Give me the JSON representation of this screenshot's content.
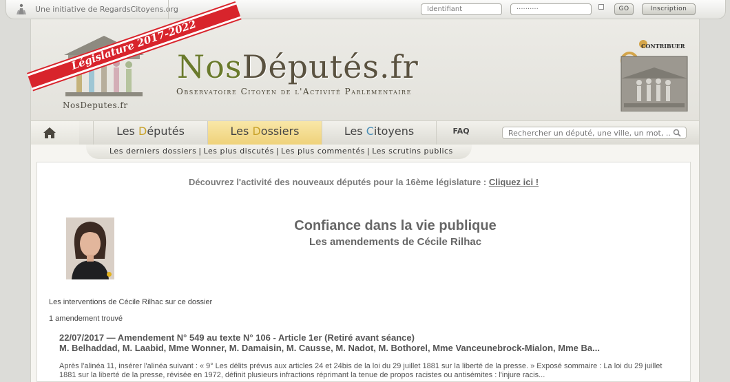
{
  "topbar": {
    "initiative_text": "Une initiative de RegardsCitoyens.org",
    "login_placeholder": "Identifiant",
    "password_placeholder": "··········",
    "go_label": "GO",
    "signup_label": "Inscription"
  },
  "header": {
    "banner": "Législature 2017-2022",
    "logo_name": "NosDeputes.fr",
    "title_prefix": "Nos",
    "title_rest": "Députés.fr",
    "tagline": "Observatoire Citoyen de l'Activité Parlementaire",
    "contribute": "CONTRIBUER"
  },
  "nav": {
    "tabs": [
      {
        "prefix": "Les ",
        "initial": "D",
        "rest": "éputés"
      },
      {
        "prefix": "Les ",
        "initial": "D",
        "rest": "ossiers"
      },
      {
        "prefix": "Les ",
        "initial": "C",
        "rest": "itoyens"
      }
    ],
    "faq": "FAQ",
    "search_placeholder": "Rechercher un député, une ville, un mot, ...",
    "sublinks": [
      "Les derniers dossiers",
      "Les plus discutés",
      "Les plus commentés",
      "Les scrutins publics"
    ]
  },
  "content": {
    "announce_text": "Découvrez l'activité des nouveaux députés pour la 16ème législature : ",
    "announce_link": "Cliquez ici !",
    "dossier_title": "Confiance dans la vie publique",
    "dossier_subtitle": "Les amendements de Cécile Rilhac",
    "interventions_link": "Les interventions de Cécile Rilhac sur ce dossier",
    "count": "1 amendement trouvé",
    "amendment": {
      "title": "22/07/2017 — Amendement N° 549 au texte N° 106 - Article 1er (Retiré avant séance)",
      "authors": "M. Belhaddad, M. Laabid, Mme Wonner, M. Damaisin, M. Causse, M. Nadot, M. Bothorel, Mme Vanceunebrock-Mialon, Mme Ba...",
      "excerpt": "Après l'alinéa 11, insérer l'alinéa suivant : « 9° Les délits prévus aux articles 24 et 24bis de la loi du 29 juillet 1881 sur la liberté de la presse. » Exposé sommaire : La loi du 29 juillet 1881 sur la liberté de la presse, révisée en 1972, définit plusieurs infractions réprimant la tenue de propos racistes ou antisémites : l'injure racis..."
    }
  },
  "colors": {
    "accent_gold": "#c9a22a",
    "accent_blue": "#4a8fb8",
    "banner_red": "#d8242c",
    "active_tab": "#efd27a"
  }
}
